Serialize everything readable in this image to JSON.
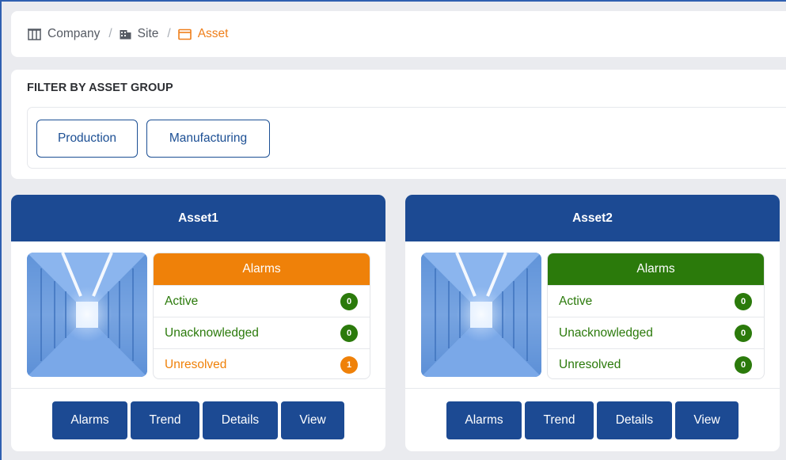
{
  "breadcrumb": {
    "items": [
      {
        "label": "Company",
        "icon": "columns-icon"
      },
      {
        "label": "Site",
        "icon": "building-icon"
      },
      {
        "label": "Asset",
        "icon": "window-icon"
      }
    ],
    "separator": "/"
  },
  "filter": {
    "title": "FILTER BY ASSET GROUP",
    "groups": [
      "Production",
      "Manufacturing"
    ]
  },
  "assets": [
    {
      "name": "Asset1",
      "alarms": {
        "title": "Alarms",
        "header_color": "#ef8109",
        "rows": [
          {
            "label": "Active",
            "count": "0",
            "status": "ok"
          },
          {
            "label": "Unacknowledged",
            "count": "0",
            "status": "ok"
          },
          {
            "label": "Unresolved",
            "count": "1",
            "status": "warn"
          }
        ]
      },
      "actions": [
        "Alarms",
        "Trend",
        "Details",
        "View"
      ]
    },
    {
      "name": "Asset2",
      "alarms": {
        "title": "Alarms",
        "header_color": "#2b7a0b",
        "rows": [
          {
            "label": "Active",
            "count": "0",
            "status": "ok"
          },
          {
            "label": "Unacknowledged",
            "count": "0",
            "status": "ok"
          },
          {
            "label": "Unresolved",
            "count": "0",
            "status": "ok"
          }
        ]
      },
      "actions": [
        "Alarms",
        "Trend",
        "Details",
        "View"
      ]
    }
  ],
  "colors": {
    "brand": "#1c4a93",
    "ok": "#2b7a0b",
    "warn": "#ef8109",
    "active_crumb": "#ef7f1a"
  }
}
